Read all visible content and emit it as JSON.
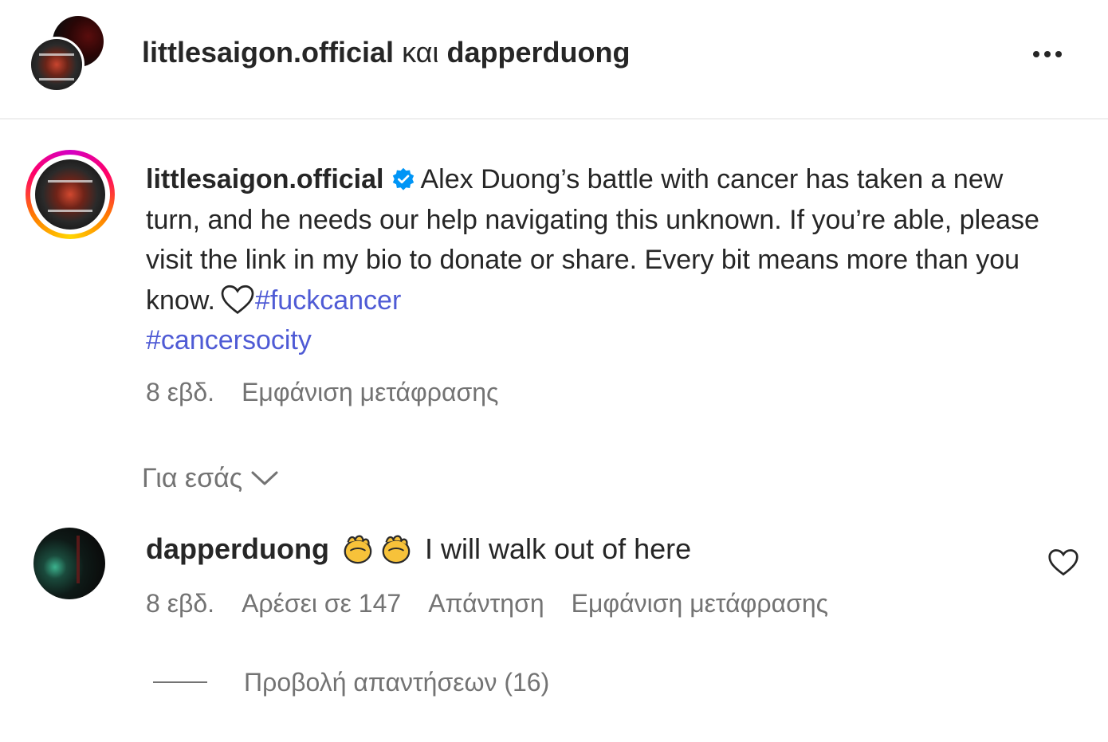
{
  "header": {
    "user1": "littlesaigon.official",
    "conjunction": "και",
    "user2": "dapperduong"
  },
  "caption": {
    "username": "littlesaigon.official",
    "text": "Alex Duong’s battle with cancer has taken a new turn, and he needs our help navigating this unknown. If you’re able, please visit the link in my bio to donate or share. Every bit means more than you know.",
    "hashtags": [
      "#fuckcancer",
      "#cancersocity"
    ],
    "time": "8 εβδ.",
    "translate_label": "Εμφάνιση μετάφρασης"
  },
  "filter": {
    "label": "Για εσάς"
  },
  "comment": {
    "username": "dapperduong",
    "text": "I will walk out of here",
    "emoji": [
      "clapping-hands",
      "clapping-hands"
    ],
    "time": "8 εβδ.",
    "likes": "Αρέσει σε 147",
    "reply_label": "Απάντηση",
    "translate_label": "Εμφάνιση μετάφρασης",
    "view_replies": "Προβολή απαντήσεων (16)"
  },
  "colors": {
    "text": "#262626",
    "secondary": "#737373",
    "hashtag": "#4f5bd5",
    "verified": "#0095f6"
  },
  "icons": [
    "more-icon",
    "verified-badge-icon",
    "heart-icon",
    "chevron-down-icon",
    "clap-icon",
    "like-heart-icon"
  ]
}
